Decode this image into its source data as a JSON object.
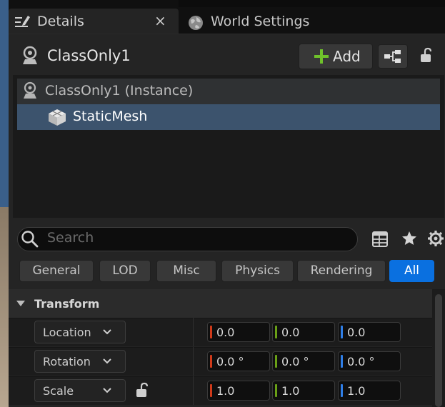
{
  "tabs": [
    {
      "label": "Details",
      "close": "×"
    },
    {
      "label": "World Settings"
    }
  ],
  "actor": {
    "name": "ClassOnly1"
  },
  "toolbar": {
    "add_label": "Add"
  },
  "tree": [
    {
      "label": "ClassOnly1 (Instance)"
    },
    {
      "label": "StaticMesh",
      "selected": true
    }
  ],
  "search": {
    "placeholder": "Search"
  },
  "filters": [
    "General",
    "LOD",
    "Misc",
    "Physics",
    "Rendering",
    "All"
  ],
  "active_filter": "All",
  "section": {
    "title": "Transform"
  },
  "transform": [
    {
      "label": "Location",
      "values": [
        "0.0",
        "0.0",
        "0.0"
      ]
    },
    {
      "label": "Rotation",
      "values": [
        "0.0 °",
        "0.0 °",
        "0.0 °"
      ]
    },
    {
      "label": "Scale",
      "values": [
        "1.0",
        "1.0",
        "1.0"
      ]
    }
  ],
  "axis_colors": {
    "x": "#d03a1a",
    "y": "#6aa016",
    "z": "#2f7ee6"
  },
  "accent": "#0a70e0",
  "icons": {
    "details_tab": "pencil-list-icon",
    "world_tab": "globe-icon",
    "actor": "actor-pawn-icon",
    "add": "plus-icon",
    "blueprint": "blueprint-graph-icon",
    "lock": "lock-icon",
    "mesh": "static-mesh-cube-icon",
    "search": "search-icon",
    "grid": "grid-view-icon",
    "star": "star-icon",
    "settings": "gear-icon",
    "collapse": "triangle-down-icon",
    "dropdown": "chevron-down-icon"
  }
}
